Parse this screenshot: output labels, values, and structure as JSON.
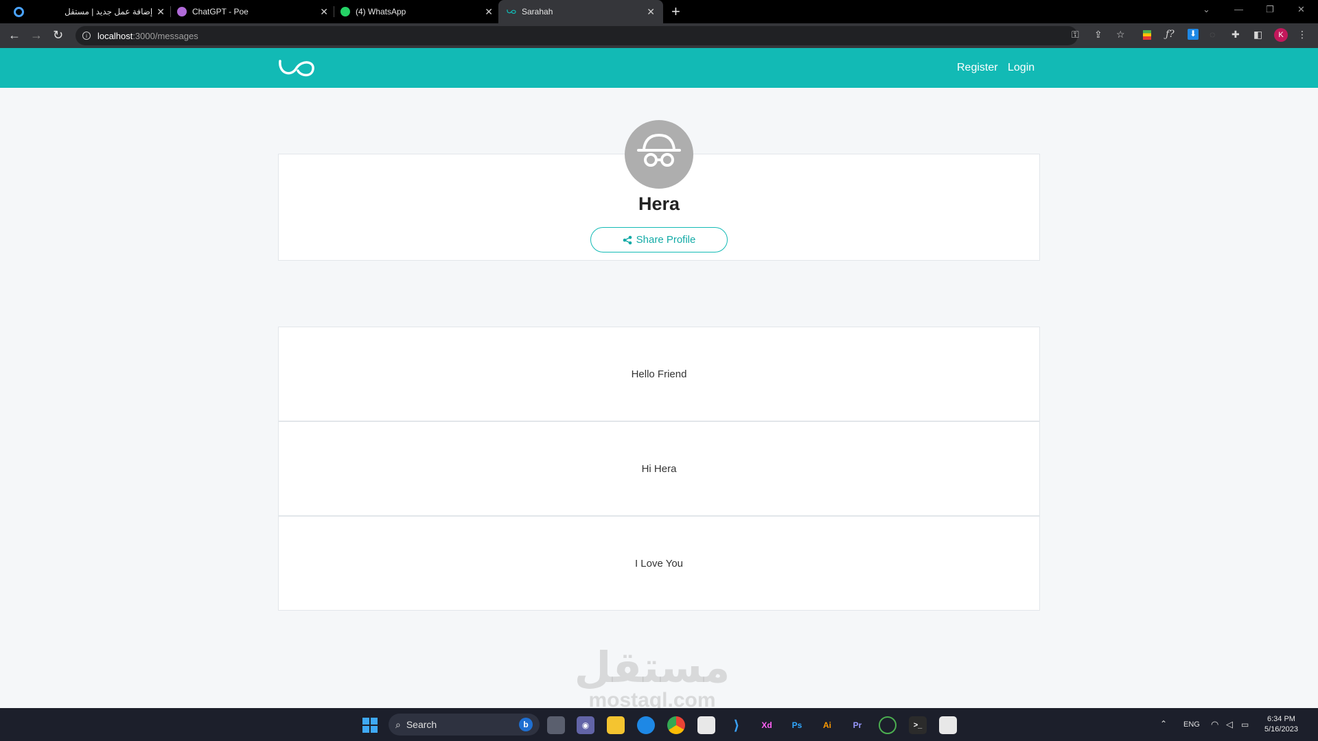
{
  "browser": {
    "tabs": [
      {
        "title": "إضافة عمل جديد | مستقل",
        "favicon_color": "#ffffff"
      },
      {
        "title": "ChatGPT - Poe",
        "favicon_color": "#b06ad8"
      },
      {
        "title": "(4) WhatsApp",
        "favicon_color": "#25d366"
      },
      {
        "title": "Sarahah",
        "favicon_color": "#12bab5"
      }
    ],
    "active_tab_index": 3,
    "url_host": "localhost",
    "url_path": ":3000/messages",
    "profile_initial": "K"
  },
  "site": {
    "brand_color": "#12bab5",
    "nav": {
      "register": "Register",
      "login": "Login"
    },
    "profile": {
      "name": "Hera",
      "share_label": "Share Profile"
    },
    "messages": [
      {
        "text": "Hello Friend"
      },
      {
        "text": "Hi Hera"
      },
      {
        "text": "I Love You"
      }
    ]
  },
  "watermark": {
    "arabic": "مستقل",
    "latin": "mostaql.com"
  },
  "taskbar": {
    "search_label": "Search",
    "apps": [
      {
        "label": "Xd",
        "color": "#ff61f6",
        "bg": "#470137"
      },
      {
        "label": "Ps",
        "color": "#31a8ff",
        "bg": "#001e36"
      },
      {
        "label": "Ai",
        "color": "#ff9a00",
        "bg": "#330000"
      },
      {
        "label": "Pr",
        "color": "#9999ff",
        "bg": "#00005b"
      }
    ],
    "language": "ENG",
    "time": "6:34 PM",
    "date": "5/16/2023"
  }
}
